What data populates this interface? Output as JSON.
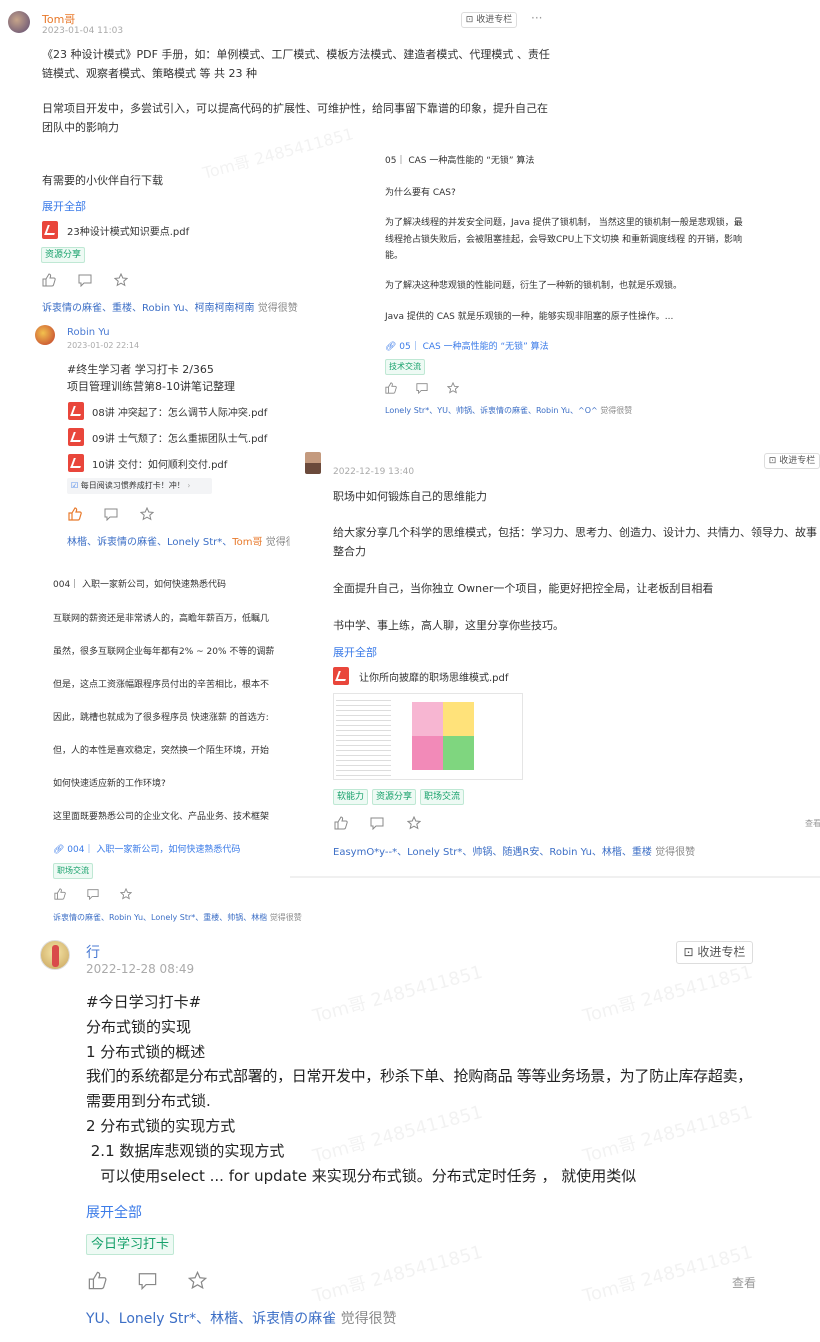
{
  "post1": {
    "author": "Tom哥",
    "time": "2023-01-04 11:03",
    "save_label": "收进专栏",
    "more": "···",
    "line1": "《23 种设计模式》PDF 手册，如：单例模式、工厂模式、模板方法模式、建造者模式、代理模式 、责任",
    "line2": "链模式、观察者模式、策略模式 等 共 23 种",
    "line3": "日常项目开发中，多尝试引入，可以提高代码的扩展性、可维护性，给同事留下靠谱的印象，提升自己在",
    "line4": "团队中的影响力",
    "line5": "有需要的小伙伴自行下载",
    "expand": "展开全部",
    "file": "23种设计模式知识要点.pdf",
    "tag": "资源分享",
    "likes": "诉衷情の麻雀、重楼、Robin Yu、柯南柯南柯南",
    "likes_suffix": "觉得很赞"
  },
  "post_cas": {
    "title": "05｜ CAS 一种高性能的 “无锁” 算法",
    "q": "为什么要有 CAS?",
    "p1a": "为了解决线程的并发安全问题，Java 提供了锁机制， 当然这里的锁机制一般是悲观锁，最",
    "p1b": "线程抢占锁失败后，会被阻塞挂起，会导致CPU上下文切换 和重新调度线程 的开销，影响",
    "p1c": "能。",
    "p2": "为了解决这种悲观锁的性能问题，衍生了一种新的锁机制，也就是乐观锁。",
    "p3": "Java 提供的 CAS  就是乐观锁的一种，能够实现非阻塞的原子性操作。...",
    "link": "05｜ CAS 一种高性能的 “无锁” 算法",
    "tag": "技术交流",
    "likes": "Lonely Str*、YU、帅锅、诉衷情の麻雀、Robin Yu、^O^",
    "likes_suffix": "觉得很赞"
  },
  "post_robin": {
    "author": "Robin Yu",
    "time": "2023-01-02 22:14",
    "line1": "#终生学习者 学习打卡 2/365",
    "line2": "项目管理训练营第8-10讲笔记整理",
    "files": [
      "08讲 冲突起了：怎么调节人际冲突.pdf",
      "09讲 士气颓了：怎么重振团队士气.pdf",
      "10讲 交付：如何顺利交付.pdf"
    ],
    "checkin": "每日阅读习惯养成打卡！冲！",
    "likes": "林楷、诉衷情の麻雀、Lonely Str*、",
    "likes_tom": "Tom哥",
    "likes_suffix": "觉得很"
  },
  "post_004": {
    "title": "004｜ 入职一家新公司，如何快速熟悉代码",
    "p1": "互联网的薪资还是非常诱人的，高瞻年薪百万，低瞩几",
    "p2": "虽然，很多互联网企业每年都有2% ~ 20% 不等的调薪",
    "p3": "但是，这点工资涨幅跟程序员付出的辛苦相比，根本不",
    "p4": "因此，跳槽也就成为了很多程序员 快速涨薪 的首选方:",
    "p5": "但，人的本性是喜欢稳定，突然换一个陌生环境，开始",
    "p6": "如何快速适应新的工作环境?",
    "p7": "这里面既要熟悉公司的企业文化、产品业务、技术框架",
    "link": "004｜ 入职一家新公司，如何快速熟悉代码",
    "tag": "职场交流",
    "likes": "诉衷情の麻雀、Robin Yu、Lonely Str*、重楼、帅锅、林楷",
    "likes_suffix": "觉得很赞"
  },
  "post_mind": {
    "time": "2022-12-19 13:40",
    "save_label": "收进专栏",
    "line1": "职场中如何锻炼自己的思维能力",
    "line2a": "给大家分享几个科学的思维模式，包括：学习力、思考力、创造力、设计力、共情力、领导力、故事",
    "line2b": "整合力",
    "line3": "全面提升自己，当你独立 Owner一个项目，能更好把控全局，让老板刮目相看",
    "line4": "书中学、事上练，高人聊，这里分享你些技巧。",
    "expand": "展开全部",
    "file": "让你所向披靡的职场思维模式.pdf",
    "tags": [
      "软能力",
      "资源分享",
      "职场交流"
    ],
    "view": "查看",
    "likes": "EasymO*y--*、Lonely Str*、帅锅、随遇R安、Robin Yu、林楷、重楼",
    "likes_suffix": "觉得很赞"
  },
  "post_lock": {
    "author": "行",
    "time": "2022-12-28 08:49",
    "save_label": "收进专栏",
    "l1": "#今日学习打卡#",
    "l2": "分布式锁的实现",
    "l3": "1 分布式锁的概述",
    "l4": "我们的系统都是分布式部署的，日常开发中，秒杀下单、抢购商品 等等业务场景，为了防止库存超卖，",
    "l5": "需要用到分布式锁.",
    "l6": "2 分布式锁的实现方式",
    "l7": " 2.1 数据库悲观锁的实现方式",
    "l8": "   可以使用select ... for update 来实现分布式锁。分布式定时任务 ， 就使用类似",
    "expand": "展开全部",
    "tag": "今日学习打卡",
    "view": "查看",
    "likes": "YU、Lonely Str*、林楷、诉衷情の麻雀",
    "likes_suffix": "觉得很赞"
  },
  "watermark": "Tom哥 2485411851",
  "icons": [
    "like-icon",
    "comment-icon",
    "star-icon",
    "pdf-icon",
    "link-icon",
    "bookmark-icon"
  ]
}
